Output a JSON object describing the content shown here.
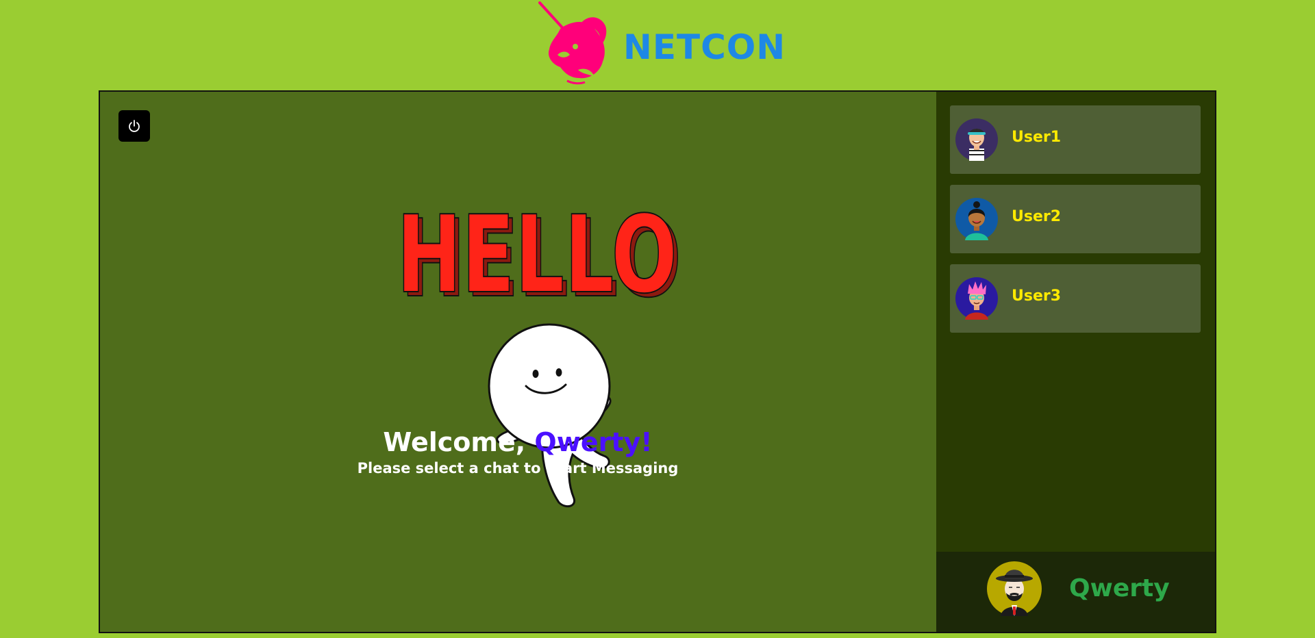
{
  "header": {
    "brand": "NETCON"
  },
  "hero": {
    "art_word": "HELLO"
  },
  "welcome": {
    "greeting": "Welcome,",
    "username": "Qwerty!",
    "subtitle": "Please select a chat to Start Messaging"
  },
  "contacts": [
    {
      "name": "User1"
    },
    {
      "name": "User2"
    },
    {
      "name": "User3"
    }
  ],
  "current_user": {
    "name": "Qwerty"
  },
  "colors": {
    "page_bg": "#9acd32",
    "main_bg": "#4f6d1b",
    "sidebar_bg": "#293b03",
    "brand": "#1e88e5",
    "logo": "#ff007a",
    "contact_name": "#ffea00",
    "current_user_name": "#2ea84a",
    "welcome_name": "#4b10ff"
  }
}
